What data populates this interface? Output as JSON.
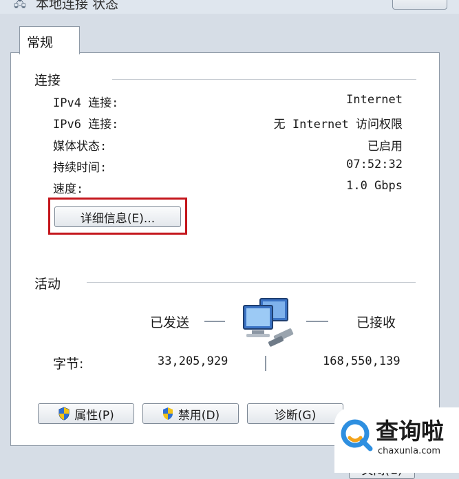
{
  "window": {
    "title": "本地连接 状态",
    "close_label": ""
  },
  "tab": {
    "label": "常规"
  },
  "connection": {
    "section_title": "连接",
    "rows": [
      {
        "label": "IPv4 连接:",
        "value": "Internet"
      },
      {
        "label": "IPv6 连接:",
        "value": "无 Internet 访问权限"
      },
      {
        "label": "媒体状态:",
        "value": "已启用"
      },
      {
        "label": "持续时间:",
        "value": "07:52:32"
      },
      {
        "label": "速度:",
        "value": "1.0 Gbps"
      }
    ],
    "details_button": "详细信息(E)..."
  },
  "activity": {
    "section_title": "活动",
    "sent_label": "已发送",
    "received_label": "已接收",
    "bytes_label": "字节:",
    "bytes_sent": "33,205,929",
    "bytes_received": "168,550,139"
  },
  "buttons": {
    "properties": "属性(P)",
    "disable": "禁用(D)",
    "diagnose": "诊断(G)",
    "close": "关闭(C)"
  },
  "watermark": {
    "brand": "查询啦",
    "url": "chaxunla.com"
  },
  "colors": {
    "highlight": "#c4161c",
    "watermark_accent": "#2e8fe0"
  }
}
